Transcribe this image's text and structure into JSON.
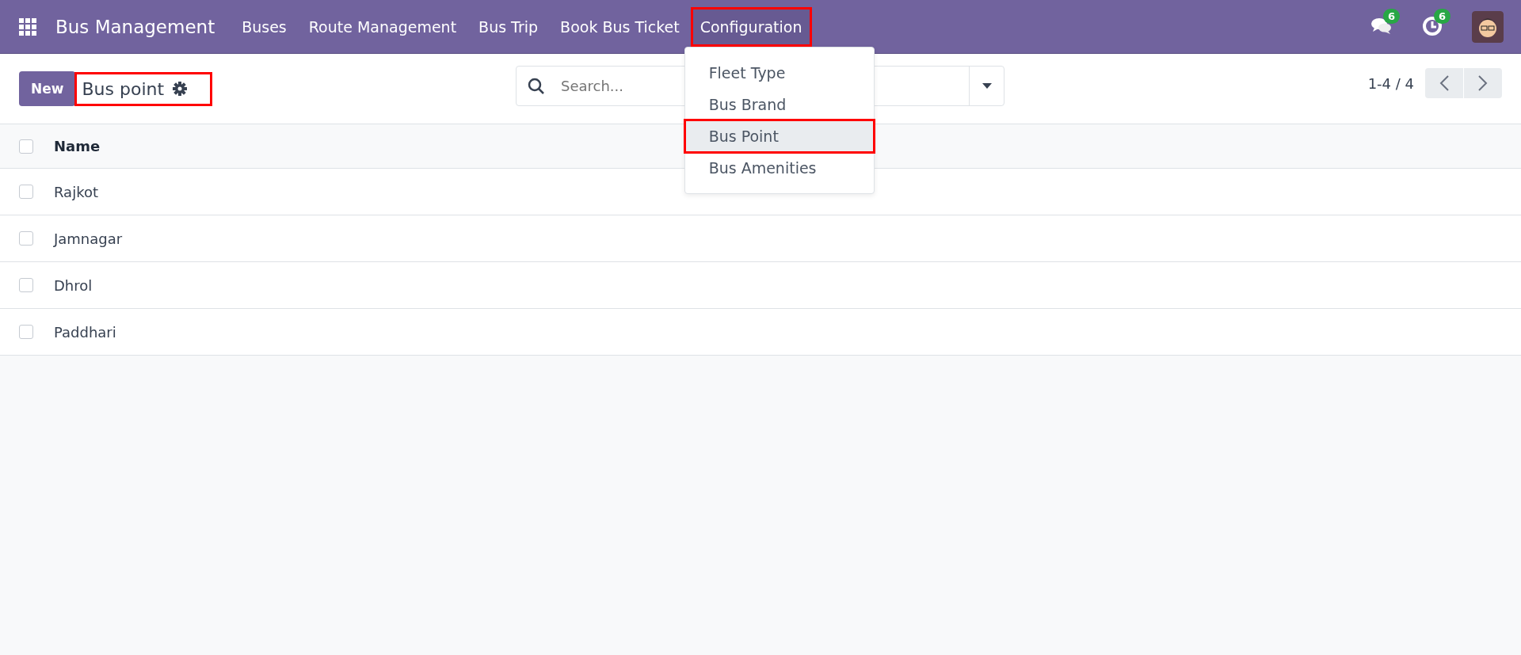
{
  "navbar": {
    "brand": "Bus Management",
    "menus": [
      {
        "label": "Buses",
        "highlighted": false
      },
      {
        "label": "Route Management",
        "highlighted": false
      },
      {
        "label": "Bus Trip",
        "highlighted": false
      },
      {
        "label": "Book Bus Ticket",
        "highlighted": false
      },
      {
        "label": "Configuration",
        "highlighted": true
      }
    ],
    "messages_badge": "6",
    "activities_badge": "6"
  },
  "dropdown": {
    "items": [
      {
        "label": "Fleet Type",
        "selected": false,
        "highlighted": false
      },
      {
        "label": "Bus Brand",
        "selected": false,
        "highlighted": false
      },
      {
        "label": "Bus Point",
        "selected": true,
        "highlighted": true
      },
      {
        "label": "Bus Amenities",
        "selected": false,
        "highlighted": false
      }
    ]
  },
  "control_panel": {
    "new_button": "New",
    "breadcrumb": "Bus point",
    "breadcrumb_highlighted": true,
    "search": {
      "placeholder": "Search..."
    },
    "pager": "1-4 / 4"
  },
  "table": {
    "select_all_checked": false,
    "columns": [
      "Name"
    ],
    "rows": [
      {
        "name": "Rajkot",
        "checked": false
      },
      {
        "name": "Jamnagar",
        "checked": false
      },
      {
        "name": "Dhrol",
        "checked": false
      },
      {
        "name": "Paddhari",
        "checked": false
      }
    ]
  }
}
